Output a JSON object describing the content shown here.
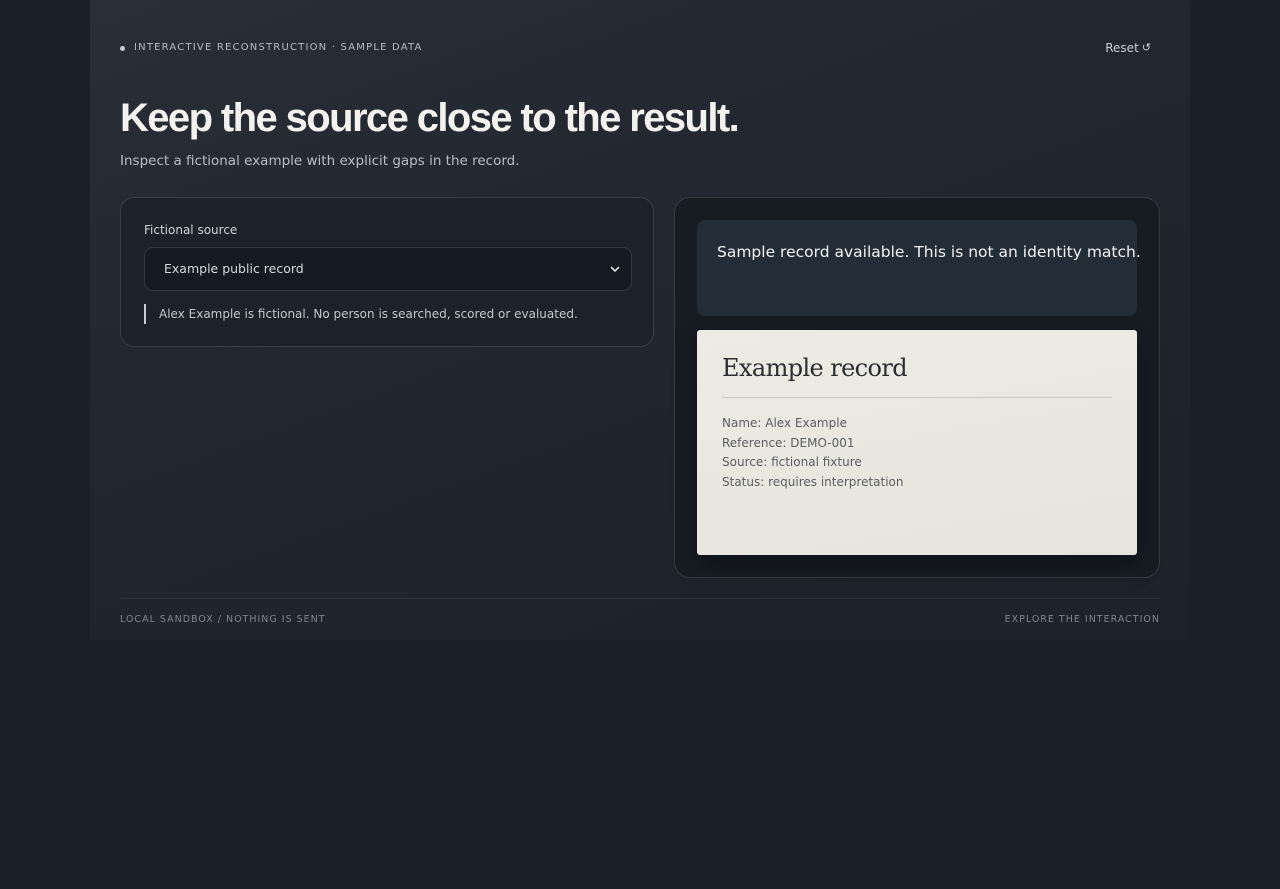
{
  "header": {
    "eyebrow": "INTERACTIVE RECONSTRUCTION · SAMPLE DATA",
    "reset_label": "Reset",
    "reset_icon": "↺",
    "title": "Keep the source close to the result.",
    "subtitle": "Inspect a fictional example with explicit gaps in the record."
  },
  "source_panel": {
    "label": "Fictional source",
    "selected_option": "Example public record",
    "note": "Alex Example is fictional. No person is searched, scored or evaluated."
  },
  "result_panel": {
    "status": "Sample record available. This is not an identity match.",
    "record": {
      "title": "Example record",
      "lines": [
        "Name: Alex Example",
        "Reference: DEMO-001",
        "Source: fictional fixture",
        "Status: requires interpretation"
      ]
    }
  },
  "footer": {
    "left": "LOCAL SANDBOX / NOTHING IS SENT",
    "right": "EXPLORE THE INTERACTION"
  },
  "colors": {
    "page_background": "#1b1f27",
    "card_background": "#1d222a",
    "status_background": "#222d38",
    "paper_background": "#ecebe4",
    "heading_text": "#f3f2ee"
  },
  "icons": {
    "reset": "refresh-icon",
    "select": "chevron-down-icon",
    "eyebrow": "bullet-dot-icon"
  }
}
